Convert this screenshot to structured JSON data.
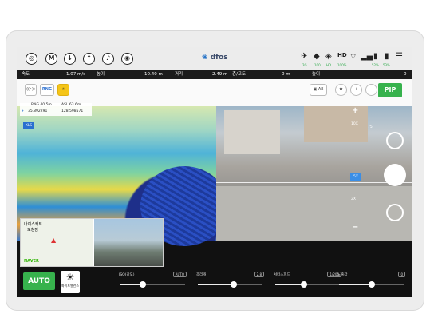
{
  "topbar": {
    "brand_symbol": "❀",
    "brand_name": "dfos",
    "status_labels": [
      "2G",
      "100",
      "HD",
      "100%",
      "52%",
      "53%"
    ]
  },
  "telemetry": [
    {
      "key": "속도",
      "value": "1.07 m/s"
    },
    {
      "key": "높이",
      "value": "10.40 m"
    },
    {
      "key": "거리",
      "value": "2.49 m"
    },
    {
      "key": "층/고도",
      "value": "0 m"
    },
    {
      "key": "높이",
      "value": "0"
    }
  ],
  "tools": {
    "ae_label": "AE",
    "pip_label": "PIP",
    "rng_label": "RNG"
  },
  "info": {
    "rng": "RNG 40.5m",
    "asl": "ASL 63.6m",
    "lat": "35.892291",
    "lon": "128.598571",
    "badge": "XLS"
  },
  "zoom": {
    "levels": [
      "10X",
      "5X",
      "2X"
    ],
    "selected": "5X",
    "side_value": "75"
  },
  "pip_map": {
    "place_line1": "나이스커트",
    "place_line2": "도청점",
    "provider": "NAVER"
  },
  "bottom": {
    "auto_label": "AUTO",
    "wb_label": "화이트밸런스",
    "sliders": [
      {
        "name": "ISO(감도)",
        "value": "AUTO",
        "level": 0.35
      },
      {
        "name": "조리개",
        "value": "2.8",
        "level": 0.55
      },
      {
        "name": "셔터스피드",
        "value": "1/200",
        "level": 0.45
      },
      {
        "name": "노출값",
        "value": "0",
        "level": 0.5
      }
    ]
  }
}
